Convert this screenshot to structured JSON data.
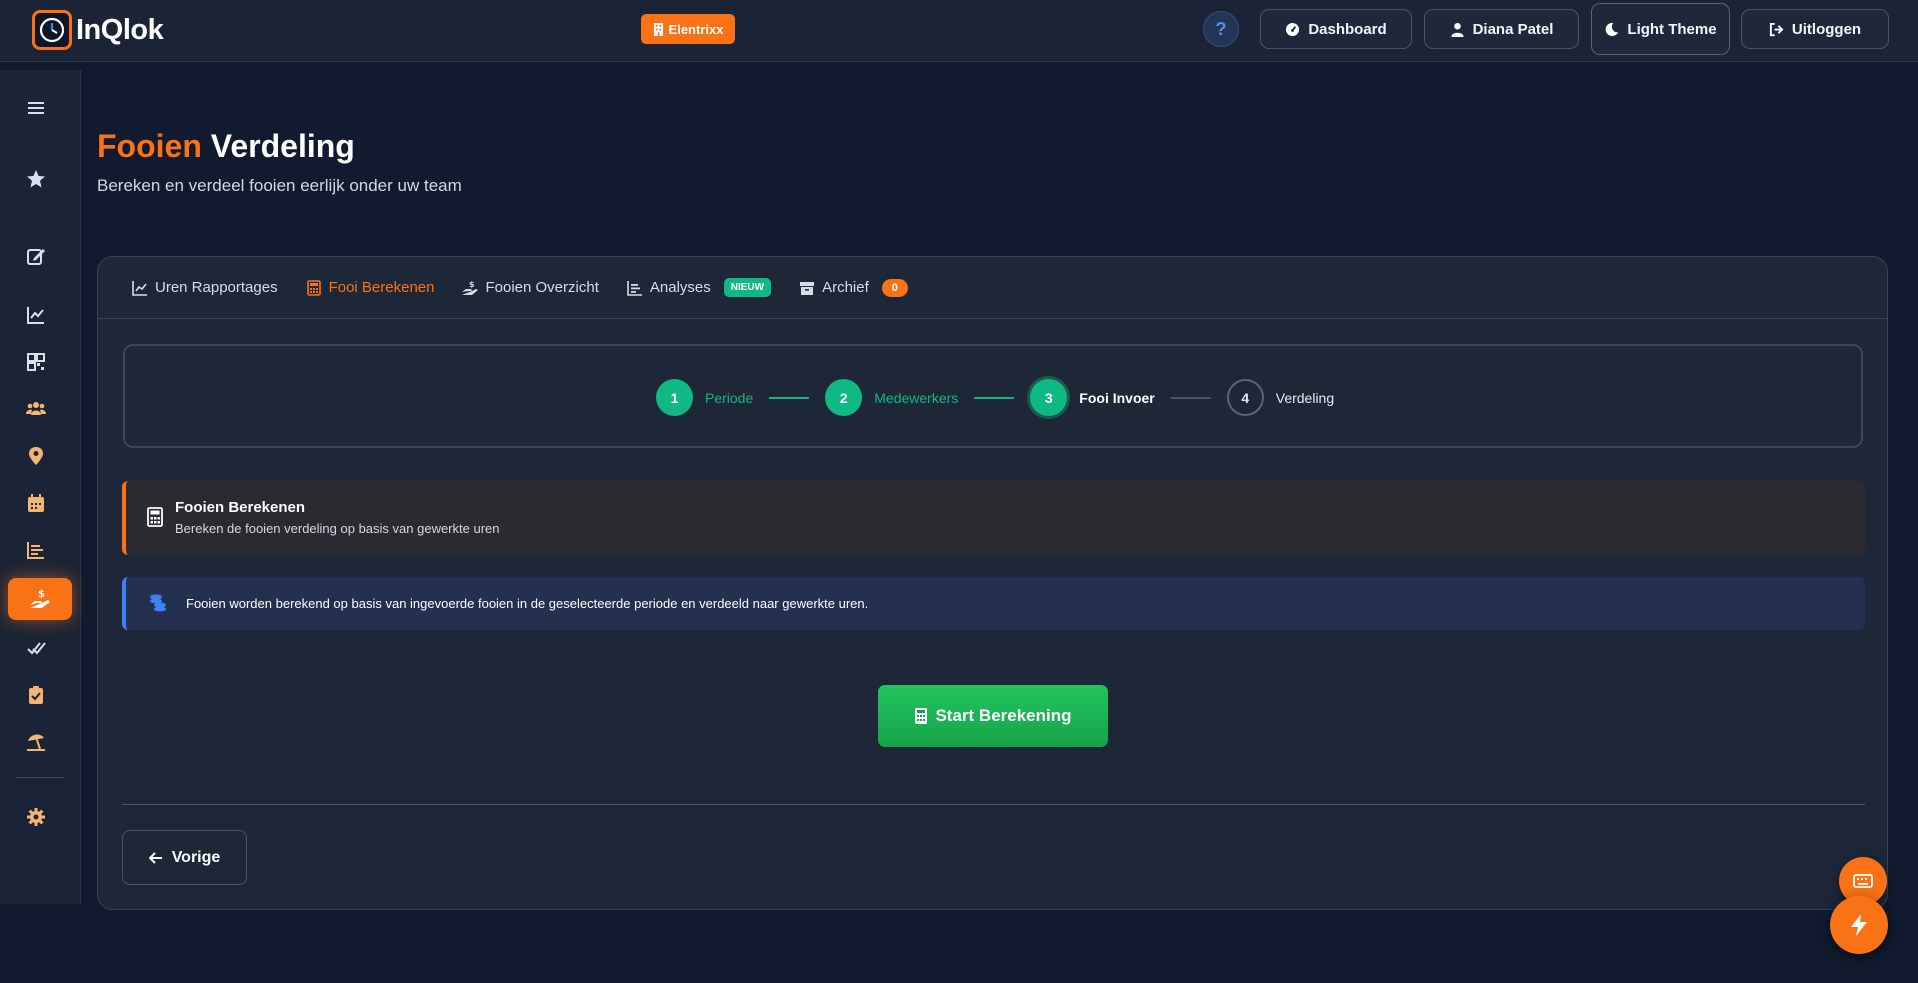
{
  "app": {
    "logo_text": "InQlok",
    "company": "Elentrixx"
  },
  "topbar": {
    "help_label": "?",
    "dashboard_label": "Dashboard",
    "user_label": "Diana Patel",
    "theme_label": "Light Theme",
    "logout_label": "Uitloggen"
  },
  "sidebar": {
    "items": [
      {
        "icon": "menu-icon"
      },
      {
        "icon": "star-icon"
      },
      {
        "icon": "edit-icon"
      },
      {
        "icon": "chart-line-icon"
      },
      {
        "icon": "qr-code-icon"
      },
      {
        "icon": "users-icon"
      },
      {
        "icon": "location-pin-icon"
      },
      {
        "icon": "calendar-icon"
      },
      {
        "icon": "bar-chart-icon"
      },
      {
        "icon": "hand-dollar-icon",
        "active": true
      },
      {
        "icon": "double-check-icon"
      },
      {
        "icon": "clipboard-check-icon"
      },
      {
        "icon": "umbrella-beach-icon"
      },
      {
        "icon": "gear-icon"
      }
    ]
  },
  "page": {
    "title_accent": "Fooien",
    "title_rest": "Verdeling",
    "subtitle": "Bereken en verdeel fooien eerlijk onder uw team"
  },
  "tabs": [
    {
      "label": "Uren Rapportages"
    },
    {
      "label": "Fooi Berekenen",
      "active": true
    },
    {
      "label": "Fooien Overzicht"
    },
    {
      "label": "Analyses",
      "badge": "NIEUW"
    },
    {
      "label": "Archief",
      "badge": "0"
    }
  ],
  "stepper": {
    "steps": [
      {
        "number": "1",
        "label": "Periode",
        "state": "done"
      },
      {
        "number": "2",
        "label": "Medewerkers",
        "state": "done"
      },
      {
        "number": "3",
        "label": "Fooi Invoer",
        "state": "current"
      },
      {
        "number": "4",
        "label": "Verdeling",
        "state": "todo"
      }
    ]
  },
  "alerts": {
    "warn_title": "Fooien Berekenen",
    "warn_subtitle": "Bereken de fooien verdeling op basis van gewerkte uren",
    "info_text": "Fooien worden berekend op basis van ingevoerde fooien in de geselecteerde periode en verdeeld naar gewerkte uren."
  },
  "actions": {
    "start_label": "Start Berekening",
    "prev_label": "Vorige"
  },
  "colors": {
    "accent": "#f97316",
    "success": "#10b981",
    "info": "#3b82f6",
    "background": "#111a2e",
    "panel": "#1e2738"
  }
}
